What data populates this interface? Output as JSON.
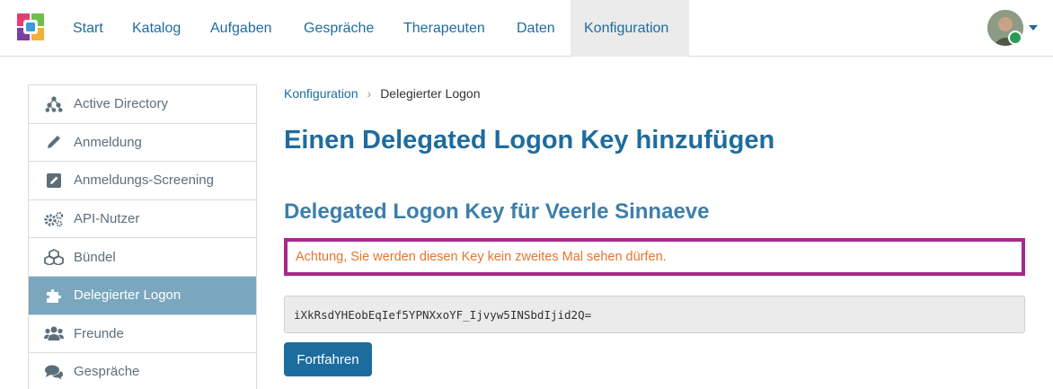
{
  "nav": {
    "items": [
      {
        "label": "Start"
      },
      {
        "label": "Katalog"
      },
      {
        "label": "Aufgaben"
      },
      {
        "label": "Gespräche"
      },
      {
        "label": "Therapeuten"
      },
      {
        "label": "Daten"
      },
      {
        "label": "Konfiguration",
        "active": true
      }
    ],
    "logo_icon": "app-logo",
    "avatar_icon": "user-avatar",
    "caret_icon": "caret-down-icon"
  },
  "sidebar": {
    "items": [
      {
        "label": "Active Directory",
        "icon": "sitemap-icon"
      },
      {
        "label": "Anmeldung",
        "icon": "pencil-icon"
      },
      {
        "label": "Anmeldungs-Screening",
        "icon": "edit-square-icon"
      },
      {
        "label": "API-Nutzer",
        "icon": "gears-icon"
      },
      {
        "label": "Bündel",
        "icon": "cubes-icon"
      },
      {
        "label": "Delegierter Logon",
        "icon": "puzzle-icon",
        "active": true
      },
      {
        "label": "Freunde",
        "icon": "users-icon"
      },
      {
        "label": "Gespräche",
        "icon": "comments-icon"
      }
    ]
  },
  "breadcrumb": {
    "parent": "Konfiguration",
    "separator": "›",
    "current": "Delegierter Logon"
  },
  "main": {
    "title": "Einen Delegated Logon Key hinzufügen",
    "subtitle": "Delegated Logon Key für Veerle Sinnaeve",
    "warning": "Achtung, Sie werden diesen Key kein zweites Mal sehen dürfen.",
    "key_value": "iXkRsdYHEobEqIef5YPNXxoYF_Ijvyw5INSbdIjid2Q=",
    "continue_label": "Fortfahren"
  },
  "colors": {
    "accent": "#1d6c9e",
    "sidebar_active": "#7aa7bd",
    "warning_border": "#a62a8a",
    "warning_text": "#e8742c"
  }
}
